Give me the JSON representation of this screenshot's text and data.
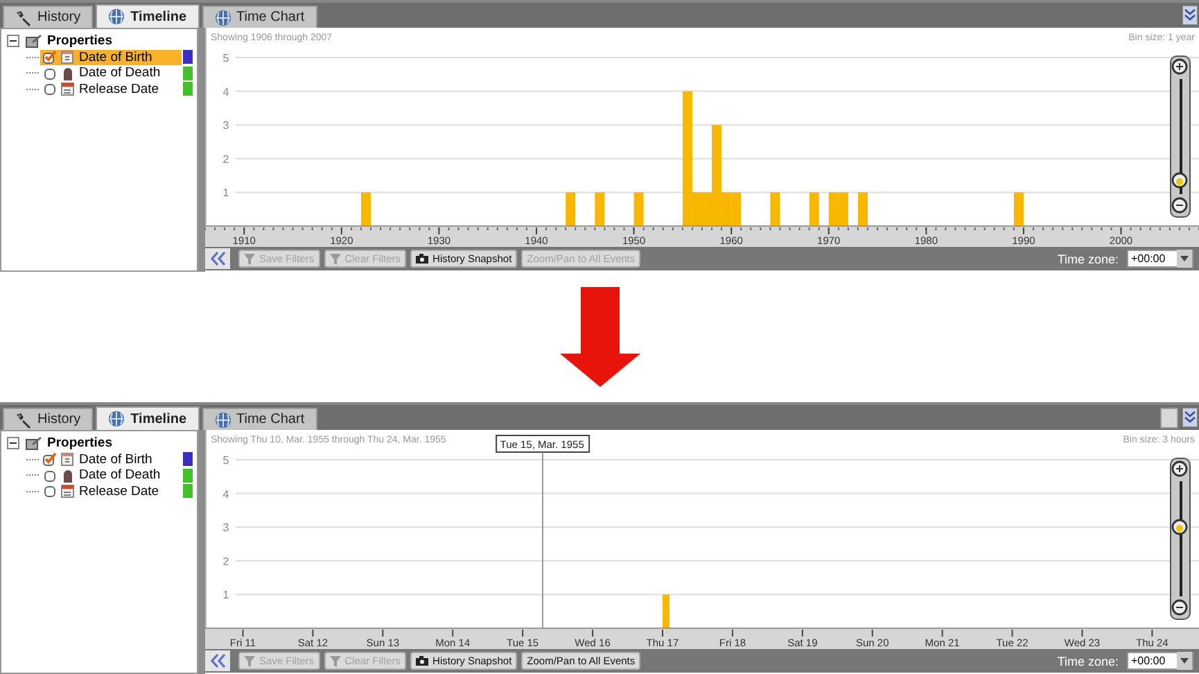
{
  "panels": [
    {
      "tabs": [
        {
          "label": "History",
          "kind": "history",
          "selected": false
        },
        {
          "label": "Timeline",
          "kind": "chart",
          "selected": true
        },
        {
          "label": "Time Chart",
          "kind": "chart",
          "selected": false
        }
      ],
      "window_controls": [
        {
          "kind": "collapse"
        }
      ],
      "tree": {
        "label": "Properties",
        "expanded": true,
        "children": [
          {
            "label": "Date of Birth",
            "kind": "birth",
            "checked": true,
            "selected": true,
            "color": "#3a2fc0"
          },
          {
            "label": "Date of Death",
            "kind": "death",
            "checked": false,
            "selected": false,
            "color": "#44c02a"
          },
          {
            "label": "Release Date",
            "kind": "release",
            "checked": false,
            "selected": false,
            "color": "#44c02a"
          }
        ]
      },
      "range_text": "Showing 1906 through 2007",
      "bin_text": "Bin size: 1 year",
      "chart_data": {
        "type": "bar",
        "x": [
          1922,
          1943,
          1946,
          1950,
          1955,
          1956,
          1957,
          1958,
          1959,
          1960,
          1964,
          1968,
          1970,
          1971,
          1973,
          1989
        ],
        "values": [
          1,
          1,
          1,
          1,
          4,
          1,
          1,
          3,
          1,
          1,
          1,
          1,
          1,
          1,
          1,
          1
        ],
        "xlim": [
          1906,
          2008
        ],
        "ylim": [
          0,
          5
        ],
        "xticks": [
          1910,
          1920,
          1930,
          1940,
          1950,
          1960,
          1970,
          1980,
          1990,
          2000
        ],
        "yticks": [
          1,
          2,
          3,
          4,
          5
        ],
        "grid": true
      },
      "zoom": {
        "level": 0.04
      },
      "toolbar": [
        {
          "label": "Save Filters",
          "kind": "filter",
          "disabled": true
        },
        {
          "label": "Clear Filters",
          "kind": "filter",
          "disabled": true
        },
        {
          "label": "History Snapshot",
          "kind": "snapshot",
          "disabled": false
        },
        {
          "label": "Zoom/Pan to All Events",
          "kind": "plain",
          "disabled": true
        }
      ],
      "timezone": {
        "label": "Time zone:",
        "value": "+00:00"
      }
    },
    {
      "tabs": [
        {
          "label": "History",
          "kind": "history",
          "selected": false
        },
        {
          "label": "Timeline",
          "kind": "chart",
          "selected": true
        },
        {
          "label": "Time Chart",
          "kind": "chart",
          "selected": false
        }
      ],
      "window_controls": [
        {
          "kind": "blank"
        },
        {
          "kind": "collapse"
        }
      ],
      "tree": {
        "label": "Properties",
        "expanded": true,
        "children": [
          {
            "label": "Date of Birth",
            "kind": "birth",
            "checked": true,
            "selected": false,
            "color": "#3a2fc0"
          },
          {
            "label": "Date of Death",
            "kind": "death",
            "checked": false,
            "selected": false,
            "color": "#44c02a"
          },
          {
            "label": "Release Date",
            "kind": "release",
            "checked": false,
            "selected": false,
            "color": "#44c02a"
          }
        ]
      },
      "range_text": "Showing Thu 10, Mar. 1955 through Thu 24, Mar. 1955",
      "bin_text": "Bin size: 3 hours",
      "chart_data": {
        "type": "bar",
        "categories": [
          "Fri 11",
          "Sat 12",
          "Sun 13",
          "Mon 14",
          "Tue 15",
          "Wed 16",
          "Thu 17",
          "Fri 18",
          "Sat 19",
          "Sun 20",
          "Mon 21",
          "Tue 22",
          "Wed 23",
          "Thu 24"
        ],
        "values": [
          null,
          null,
          null,
          null,
          null,
          null,
          1,
          null,
          null,
          null,
          null,
          null,
          null,
          null
        ],
        "ylim": [
          0,
          5
        ],
        "yticks": [
          1,
          2,
          3,
          4,
          5
        ],
        "grid": true,
        "annotations": [
          "Tue 15, Mar. 1955"
        ]
      },
      "zoom": {
        "level": 0.6
      },
      "toolbar": [
        {
          "label": "Save Filters",
          "kind": "filter",
          "disabled": true
        },
        {
          "label": "Clear Filters",
          "kind": "filter",
          "disabled": true
        },
        {
          "label": "History Snapshot",
          "kind": "snapshot",
          "disabled": false
        },
        {
          "label": "Zoom/Pan to All Events",
          "kind": "plain",
          "disabled": false
        }
      ],
      "timezone": {
        "label": "Time zone:",
        "value": "+00:00"
      }
    }
  ]
}
